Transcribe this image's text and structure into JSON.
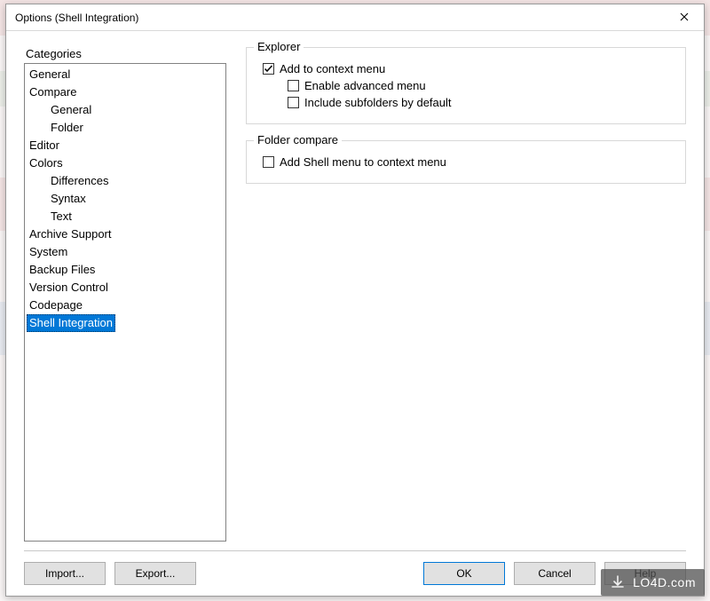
{
  "window": {
    "title": "Options (Shell Integration)"
  },
  "sidebar": {
    "label": "Categories",
    "items": [
      {
        "label": "General",
        "indent": 0,
        "selected": false
      },
      {
        "label": "Compare",
        "indent": 0,
        "selected": false
      },
      {
        "label": "General",
        "indent": 1,
        "selected": false
      },
      {
        "label": "Folder",
        "indent": 1,
        "selected": false
      },
      {
        "label": "Editor",
        "indent": 0,
        "selected": false
      },
      {
        "label": "Colors",
        "indent": 0,
        "selected": false
      },
      {
        "label": "Differences",
        "indent": 1,
        "selected": false
      },
      {
        "label": "Syntax",
        "indent": 1,
        "selected": false
      },
      {
        "label": "Text",
        "indent": 1,
        "selected": false
      },
      {
        "label": "Archive Support",
        "indent": 0,
        "selected": false
      },
      {
        "label": "System",
        "indent": 0,
        "selected": false
      },
      {
        "label": "Backup Files",
        "indent": 0,
        "selected": false
      },
      {
        "label": "Version Control",
        "indent": 0,
        "selected": false
      },
      {
        "label": "Codepage",
        "indent": 0,
        "selected": false
      },
      {
        "label": "Shell Integration",
        "indent": 0,
        "selected": true
      }
    ]
  },
  "panel": {
    "explorer": {
      "legend": "Explorer",
      "add_context": {
        "label": "Add to context menu",
        "checked": true
      },
      "enable_adv": {
        "label": "Enable advanced menu",
        "checked": false
      },
      "include_sub": {
        "label": "Include subfolders by default",
        "checked": false
      }
    },
    "folder_compare": {
      "legend": "Folder compare",
      "add_shell": {
        "label": "Add Shell menu to context menu",
        "checked": false
      }
    }
  },
  "buttons": {
    "import": "Import...",
    "export": "Export...",
    "ok": "OK",
    "cancel": "Cancel",
    "help": "Help"
  },
  "watermark": "LO4D.com"
}
